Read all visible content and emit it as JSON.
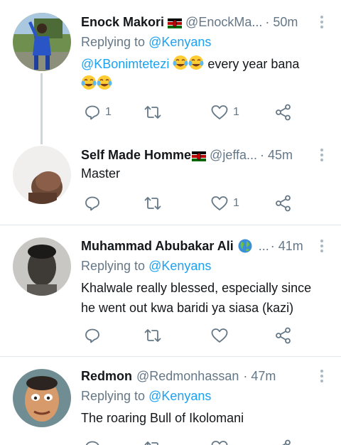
{
  "tweets": [
    {
      "name": "Enock Makori",
      "handle": "@EnockMa...",
      "time": "· 50m",
      "replying_prefix": "Replying to ",
      "replying_to": "@Kenyans",
      "mention": "@KBonimtetezi",
      "text": "every year bana",
      "replies": "1",
      "retweets": "",
      "likes": "1"
    },
    {
      "name": "Self Made Homme",
      "handle": "@jeffa...",
      "time": "· 45m",
      "text": "Master",
      "replies": "",
      "retweets": "",
      "likes": "1"
    },
    {
      "name": "Muhammad Abubakar Ali",
      "handle": "...",
      "time": "· 41m",
      "replying_prefix": "Replying to ",
      "replying_to": "@Kenyans",
      "text_line1": "Khalwale really blessed, especially since",
      "text_line2": "he went out kwa baridi ya siasa (kazi)",
      "replies": "",
      "retweets": "",
      "likes": ""
    },
    {
      "name": "Redmon",
      "handle": "@Redmonhassan",
      "time": "· 47m",
      "replying_prefix": "Replying to ",
      "replying_to": "@Kenyans",
      "text": "The roaring Bull of Ikolomani"
    }
  ],
  "colors": {
    "link": "#1da1f2",
    "secondary": "#657786",
    "divider": "#e1e8ed",
    "thread_line": "#ccd6dd"
  },
  "icons": [
    "more-vertical-icon",
    "reply-icon",
    "retweet-icon",
    "like-icon",
    "share-icon",
    "kenya-flag-icon",
    "globe-icon",
    "tears-of-joy-emoji"
  ]
}
